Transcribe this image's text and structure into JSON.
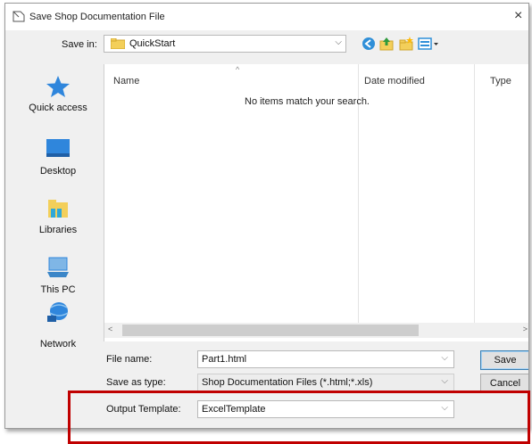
{
  "window": {
    "title": "Save Shop Documentation File",
    "close_glyph": "×"
  },
  "save_in": {
    "label": "Save in:",
    "value": "QuickStart",
    "arrow": "⌵"
  },
  "places": [
    {
      "label": "Quick access",
      "icon": "quick-access-star-icon"
    },
    {
      "label": "Desktop",
      "icon": "desktop-icon"
    },
    {
      "label": "Libraries",
      "icon": "libraries-icon"
    },
    {
      "label": "This PC",
      "icon": "this-pc-icon"
    },
    {
      "label": "Network",
      "icon": "network-icon"
    }
  ],
  "file_list": {
    "columns": [
      "Name",
      "Date modified",
      "Type"
    ],
    "sort_indicator": "^",
    "empty_message": "No items match your search.",
    "scroll_left": "<",
    "scroll_right": ">"
  },
  "form": {
    "file_name": {
      "label": "File name:",
      "value": "Part1.html"
    },
    "save_as_type": {
      "label": "Save as type:",
      "value": "Shop Documentation Files (*.html;*.xls)"
    },
    "output_template": {
      "label": "Output Template:",
      "value": "ExcelTemplate"
    },
    "dropdown_arrow": "⌵"
  },
  "buttons": {
    "save": "Save",
    "cancel": "Cancel"
  },
  "colors": {
    "highlight_box": "#c00000",
    "accent": "#3c7fb1"
  }
}
